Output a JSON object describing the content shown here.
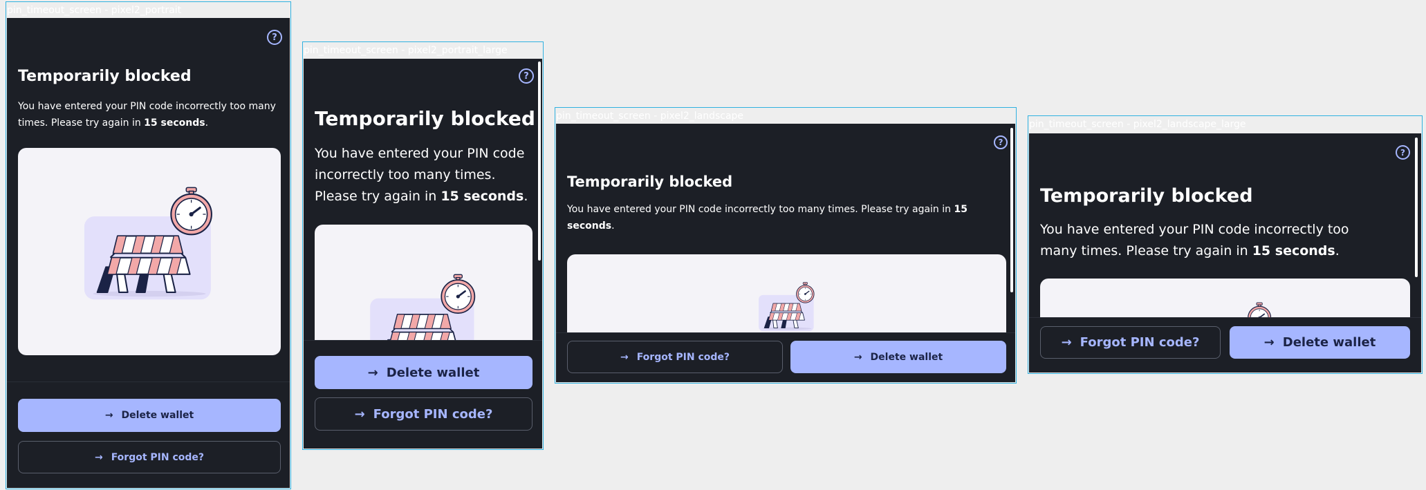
{
  "frames": [
    {
      "label": "pin_timeout_screen - pixel2_portrait"
    },
    {
      "label": "pin_timeout_screen - pixel2_portrait_large"
    },
    {
      "label": "pin_timeout_screen - pixel2_landscape"
    },
    {
      "label": "pin_timeout_screen - pixel2_landscape_large"
    }
  ],
  "screen": {
    "title": "Temporarily blocked",
    "body_prefix": "You have entered your PIN code incorrectly too many times. Please try again in ",
    "body_bold": "15 seconds",
    "body_suffix": ".",
    "delete_wallet_label": "Delete wallet",
    "forgot_pin_label": "Forgot PIN code?",
    "help_glyph": "?",
    "arrow_glyph": "→"
  },
  "icons": {
    "help": "help-circle-icon",
    "arrow": "arrow-right-icon",
    "illustration": "roadblock-stopwatch-illustration"
  },
  "colors": {
    "background": "#1c1f26",
    "primary": "#a6b6ff",
    "primary_text": "#1b2346",
    "frame_border": "#2fb1e0",
    "illustration_bg": "#f4f3f8"
  }
}
